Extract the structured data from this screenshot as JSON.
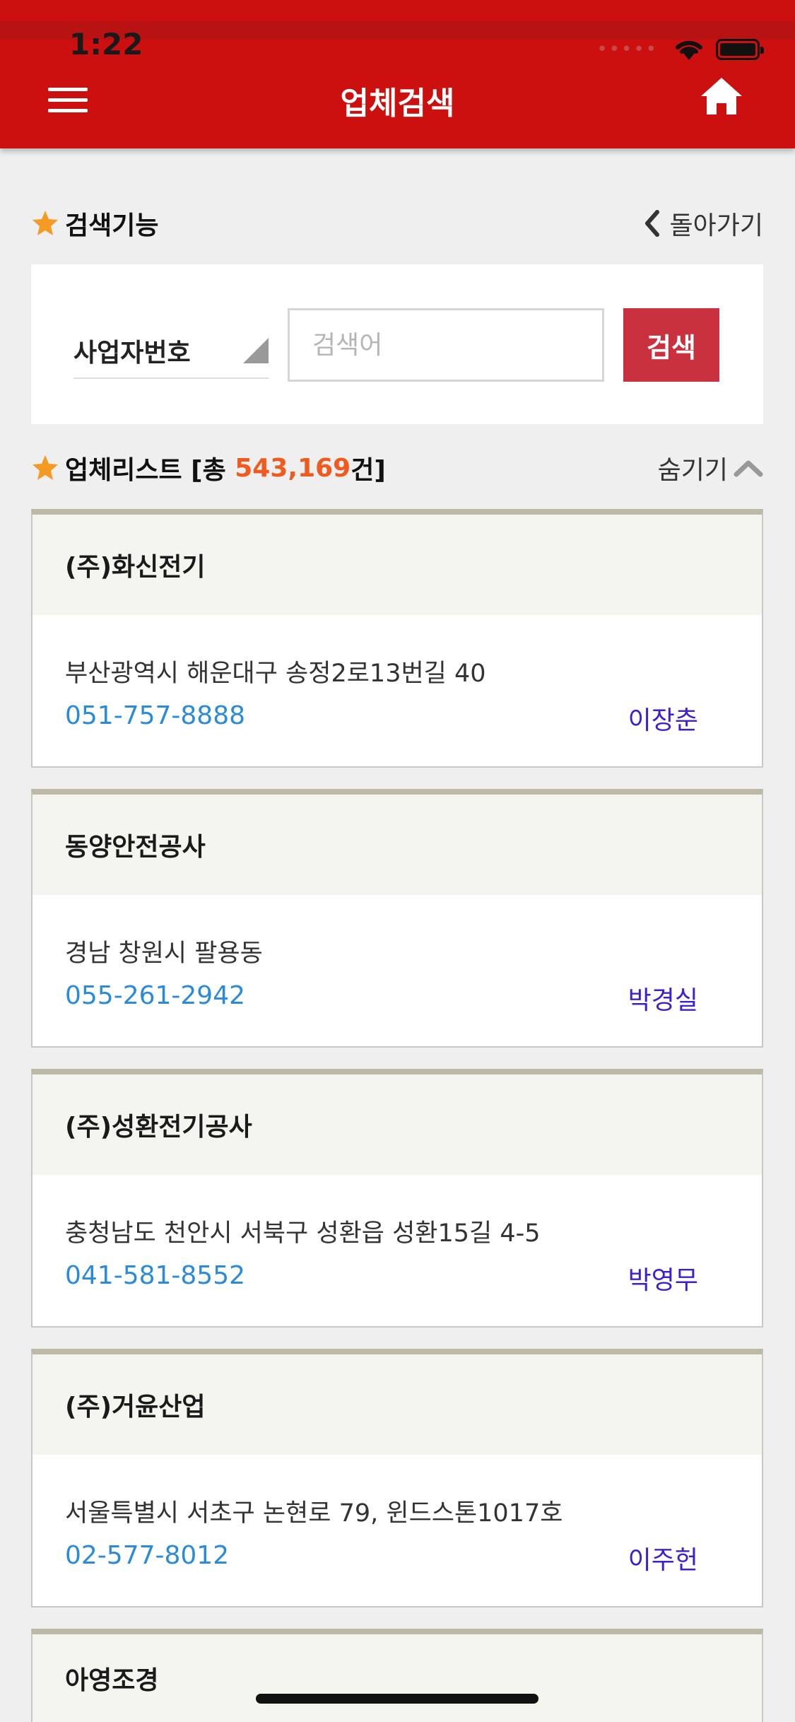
{
  "status": {
    "time": "1:22",
    "dots": "•••••"
  },
  "header": {
    "title": "업체검색"
  },
  "search_section": {
    "title": "검색기능",
    "back_label": "돌아가기"
  },
  "search": {
    "select_value": "사업자번호",
    "placeholder": "검색어",
    "button_label": "검색"
  },
  "list_section": {
    "title_prefix": "업체리스트 [총 ",
    "count": "543,169",
    "title_suffix": "건]",
    "toggle_label": "숨기기"
  },
  "companies": [
    {
      "name": "(주)화신전기",
      "address": "부산광역시 해운대구 송정2로13번길 40",
      "phone": "051-757-8888",
      "person": "이장춘"
    },
    {
      "name": "동양안전공사",
      "address": "경남 창원시 팔용동",
      "phone": "055-261-2942",
      "person": "박경실"
    },
    {
      "name": "(주)성환전기공사",
      "address": "충청남도 천안시 서북구 성환읍 성환15길 4-5",
      "phone": "041-581-8552",
      "person": "박영무"
    },
    {
      "name": "(주)거윤산업",
      "address": "서울특별시 서초구 논현로 79, 윈드스톤1017호",
      "phone": "02-577-8012",
      "person": "이주헌"
    },
    {
      "name": "아영조경"
    }
  ],
  "colors": {
    "header": "#cc1010",
    "accent_count": "#f05a1e",
    "phone": "#2b8bd8",
    "person": "#3b1fd1",
    "button": "#c9313f"
  }
}
